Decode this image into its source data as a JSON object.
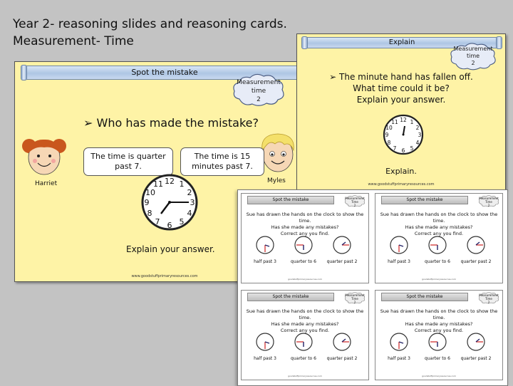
{
  "heading": {
    "line1": "Year 2- reasoning slides and reasoning cards.",
    "line2": "Measurement- Time"
  },
  "slide_left": {
    "banner": "Spot the mistake",
    "cloud_line1": "Measurement",
    "cloud_line2": "time",
    "cloud_line3": "2",
    "question": "➢ Who has made the mistake?",
    "bubble_left": "The time is quarter past 7.",
    "bubble_right": "The time is 15 minutes past 7.",
    "name_left": "Harriet",
    "name_right": "Myles",
    "explain": "Explain your answer.",
    "footer": "www.goodstuffprimaryresources.com"
  },
  "slide_right": {
    "banner": "Explain",
    "cloud_line1": "Measurement",
    "cloud_line2": "time",
    "cloud_line3": "2",
    "q1": "➢ The minute hand has fallen off.",
    "q2": "What time could it be?",
    "q3": "Explain your answer.",
    "explain": "Explain.",
    "footer": "www.goodstuffprimaryresources.com"
  },
  "cards": {
    "banner": "Spot the mistake",
    "cloud_line1": "Measurement",
    "cloud_line2": "Time",
    "cloud_line3": "2",
    "line1": "Sue has drawn the hands on the clock to show the time.",
    "line2": "Has she made any mistakes?",
    "line3": "Correct any you find.",
    "clock1": "half past 3",
    "clock2": "quarter to 6",
    "clock3": "quarter past 2",
    "footer": "goodstuffprimaryresources.com"
  },
  "clock_numbers": [
    "12",
    "1",
    "2",
    "3",
    "4",
    "5",
    "6",
    "7",
    "8",
    "9",
    "10",
    "11"
  ]
}
